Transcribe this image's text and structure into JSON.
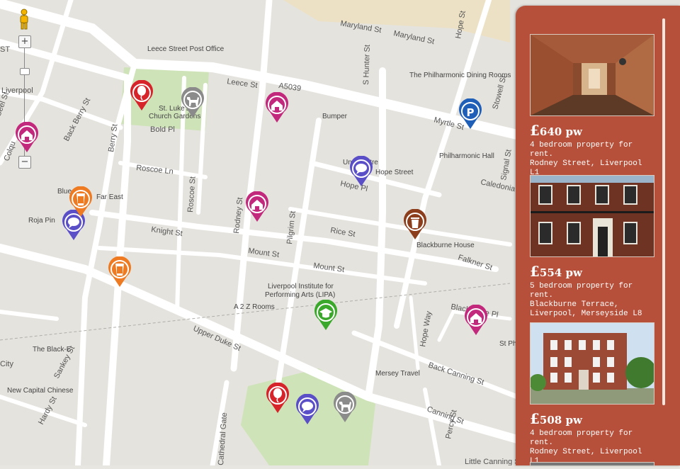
{
  "map": {
    "streets": [
      "Maryland St",
      "Maryland St",
      "Hope St",
      "Leece Street Post Office",
      "Leece St",
      "A5039",
      "S Hunter St",
      "The Philharmonic Dining Rooms",
      "Myrtle St",
      "Stowell St",
      "Bold Pl",
      "Back Berry St",
      "Berry St",
      "Bumper",
      "Philharmonic Hall",
      "Signal St",
      "Roscoe Ln",
      "Hope Street",
      "Caledonia St",
      "Hope Pl",
      "Far East",
      "Blue",
      "Roja Pin",
      "Knight St",
      "Roscoe St",
      "Rodney St",
      "Pilgrim St",
      "Rice St",
      "Mount St",
      "Mount St",
      "Blackburne House",
      "Falkner St",
      "Liverpool Institute for",
      "Performing Arts (LIPA)",
      "A 2 Z Rooms",
      "Upper Duke St",
      "Blackburne Pl",
      "Hope Way",
      "St Philip",
      "The Black-E",
      "Sankey St",
      "New Capital Chinese",
      "Hardy St",
      "Back Canning St",
      "Mersey Travel",
      "Canning St",
      "Percy St",
      "Cathedral Gate",
      "Liverpool",
      "Colqu",
      "Un Theatre",
      "Little Canning St",
      "City",
      "Seel St",
      "ST",
      "Liverpool",
      "St. Luke's",
      "Church Gardens"
    ],
    "zoom_plus": "+",
    "zoom_minus": "−",
    "zoom_level_fraction": 0.2
  },
  "panel": {
    "listings": [
      {
        "currency": "£",
        "price": "640",
        "unit": "pw",
        "line1": "4 bedroom property for rent.",
        "line2": "Rodney Street, Liverpool L1"
      },
      {
        "currency": "£",
        "price": "554",
        "unit": "pw",
        "line1": "5 bedroom property for rent.",
        "line2": "Blackburne Terrace,",
        "line3": "Liverpool, Merseyside L8"
      },
      {
        "currency": "£",
        "price": "508",
        "unit": "pw",
        "line1": "4 bedroom property for rent.",
        "line2": "Rodney Street, Liverpool L1"
      }
    ]
  },
  "colors": {
    "panel": "#b6503a",
    "home": "#c2297c",
    "chat": "#5a4fc7",
    "drink": "#ee7a22",
    "balloon": "#d6242a",
    "dog": "#8b8b8b",
    "parking": "#1f5fb8",
    "bin": "#8c3d1c",
    "school": "#3aa82a",
    "park": "#cfe3b9",
    "road": "#ffffff",
    "block": "#e4e2dd"
  }
}
